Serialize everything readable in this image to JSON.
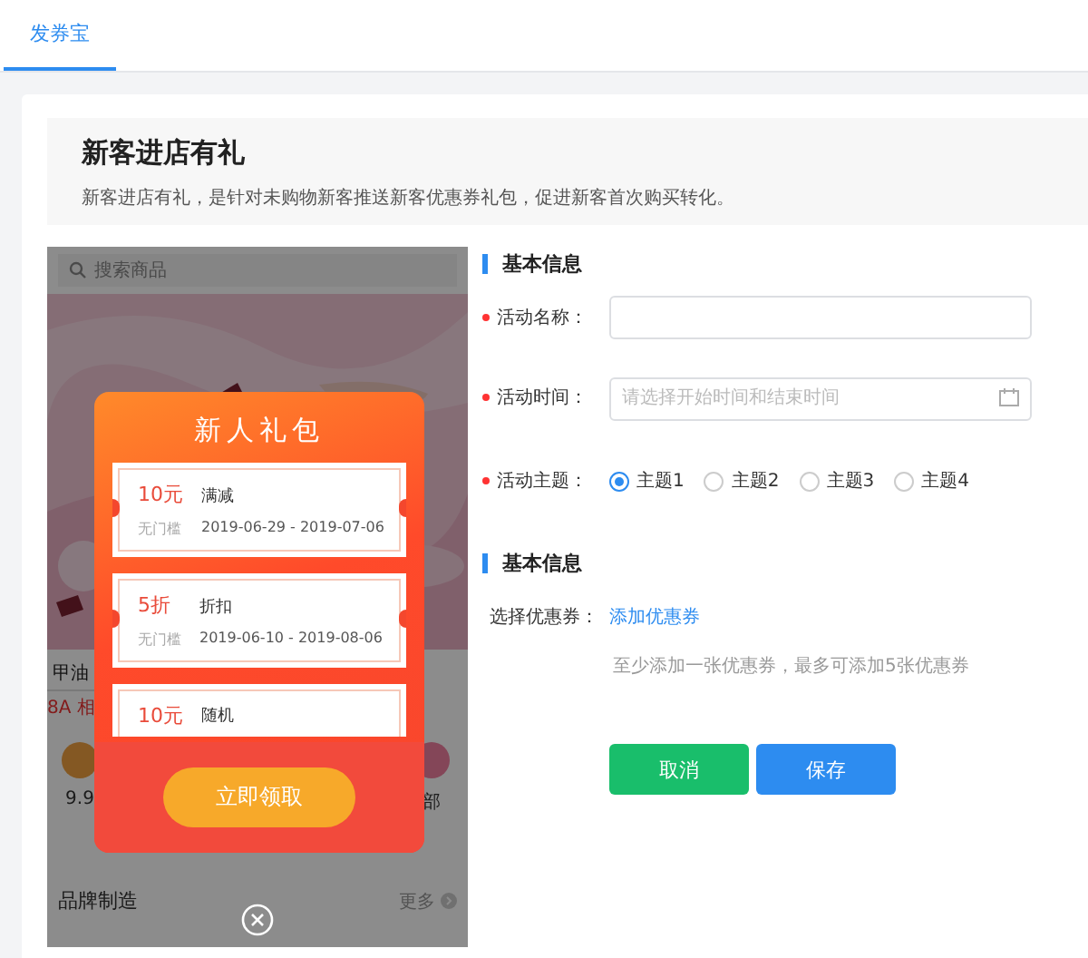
{
  "tabs": [
    {
      "label": "发券宝",
      "selected": true
    }
  ],
  "header": {
    "title": "新客进店有礼",
    "description": "新客进店有礼，是针对未购物新客推送新客优惠券礼包，促进新客首次购买转化。"
  },
  "preview": {
    "search_placeholder": "搜索商品",
    "product_title": "甲油",
    "product_tag": "8A 相",
    "shortcuts": [
      {
        "label": "9.9"
      },
      {
        "label": "部"
      }
    ],
    "section_title": "品牌制造",
    "more_label": "更多",
    "popup": {
      "title": "新人礼包",
      "button": "立即领取",
      "coupons": [
        {
          "amount": "10元",
          "threshold": "无门槛",
          "type": "满减",
          "dates": "2019-06-29 - 2019-07-06"
        },
        {
          "amount": "5折",
          "threshold": "无门槛",
          "type": "折扣",
          "dates": "2019-06-10 - 2019-08-06"
        },
        {
          "amount": "10元",
          "type": "随机"
        }
      ]
    }
  },
  "sections": [
    {
      "title": "基本信息",
      "fields": [
        {
          "kind": "text",
          "label": "活动名称：",
          "required": true
        },
        {
          "kind": "date",
          "label": "活动时间：",
          "required": true,
          "placeholder": "请选择开始时间和结束时间"
        },
        {
          "kind": "radio",
          "label": "活动主题：",
          "required": true,
          "options": [
            {
              "label": "主题1",
              "selected": true
            },
            {
              "label": "主题2",
              "selected": false
            },
            {
              "label": "主题3",
              "selected": false
            },
            {
              "label": "主题4",
              "selected": false
            }
          ]
        }
      ]
    },
    {
      "title": "基本信息",
      "fields": [
        {
          "kind": "link",
          "label": "选择优惠券：",
          "required": false,
          "link": "添加优惠券"
        },
        {
          "kind": "hint",
          "text": "至少添加一张优惠券，最多可添加5张优惠券"
        }
      ]
    }
  ],
  "buttons": [
    {
      "kind": "cancel",
      "label": "取消"
    },
    {
      "kind": "save",
      "label": "保存"
    }
  ]
}
